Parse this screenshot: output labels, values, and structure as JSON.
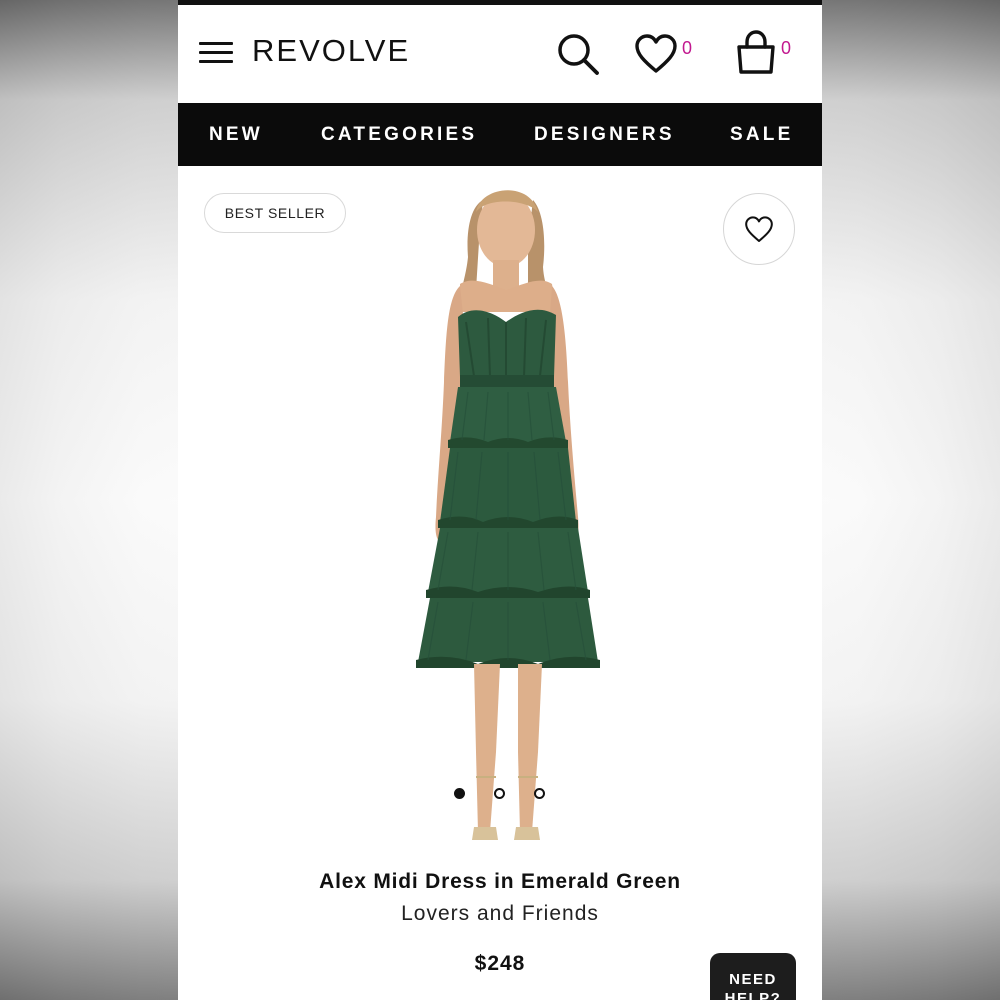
{
  "header": {
    "logo": "REVOLVE",
    "wishlist_count": "0",
    "bag_count": "0"
  },
  "nav": {
    "items": [
      {
        "label": "NEW"
      },
      {
        "label": "CATEGORIES"
      },
      {
        "label": "DESIGNERS"
      },
      {
        "label": "SALE"
      }
    ]
  },
  "product": {
    "badge": "BEST SELLER",
    "name": "Alex Midi Dress in Emerald Green",
    "brand": "Lovers and Friends",
    "price": "$248",
    "image_icon": "product-photo-green-tiered-dress",
    "carousel_active_index": 0,
    "carousel_count": 3
  },
  "help_button": {
    "label": "NEED HELP?"
  },
  "colors": {
    "nav_background": "#0b0b0b",
    "count_accent": "#c2188f",
    "dress_green": "#2d5a3f"
  }
}
